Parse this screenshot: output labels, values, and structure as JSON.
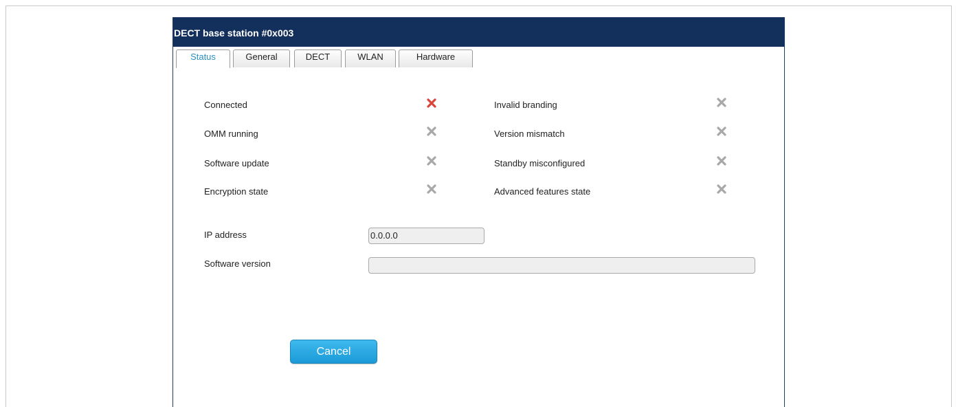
{
  "dialog": {
    "title": "DECT base station #0x003",
    "tabs": [
      {
        "label": "Status",
        "active": true
      },
      {
        "label": "General",
        "active": false
      },
      {
        "label": "DECT",
        "active": false
      },
      {
        "label": "WLAN",
        "active": false
      },
      {
        "label": "Hardware",
        "active": false
      }
    ],
    "status_items": [
      {
        "label": "Connected",
        "icon": "x-icon",
        "color": "#d9443b"
      },
      {
        "label": "OMM running",
        "icon": "x-icon",
        "color": "#a8a8a8"
      },
      {
        "label": "Software update",
        "icon": "x-icon",
        "color": "#a8a8a8"
      },
      {
        "label": "Encryption state",
        "icon": "x-icon",
        "color": "#a8a8a8"
      },
      {
        "label": "Invalid branding",
        "icon": "x-icon",
        "color": "#a8a8a8"
      },
      {
        "label": "Version mismatch",
        "icon": "x-icon",
        "color": "#a8a8a8"
      },
      {
        "label": "Standby misconfigured",
        "icon": "x-icon",
        "color": "#a8a8a8"
      },
      {
        "label": "Advanced features state",
        "icon": "x-icon",
        "color": "#a8a8a8"
      }
    ],
    "fields": {
      "ip_address": {
        "label": "IP address",
        "value": "0.0.0.0"
      },
      "software_version": {
        "label": "Software version",
        "value": ""
      }
    },
    "cancel_label": "Cancel"
  },
  "colors": {
    "titlebar": "#132f5c",
    "accent": "#1a9ad7",
    "active_tab_text": "#2a8fc0"
  }
}
